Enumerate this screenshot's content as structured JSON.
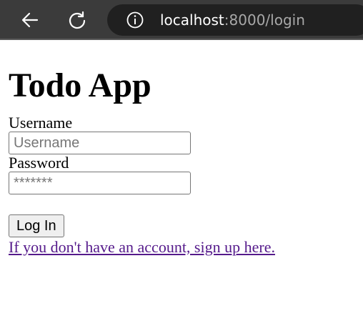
{
  "browser": {
    "url_host": "localhost",
    "url_path": ":8000/login"
  },
  "page": {
    "title": "Todo App",
    "username_label": "Username",
    "username_placeholder": "Username",
    "password_label": "Password",
    "password_placeholder": "*******",
    "login_button": "Log In",
    "signup_link": "If you don't have an account, sign up here."
  },
  "colors": {
    "toolbar_bg": "#3b3b3b",
    "address_bg": "#202020",
    "link_visited": "#551a8b"
  },
  "icons": [
    "back-arrow-icon",
    "reload-icon",
    "info-icon"
  ]
}
